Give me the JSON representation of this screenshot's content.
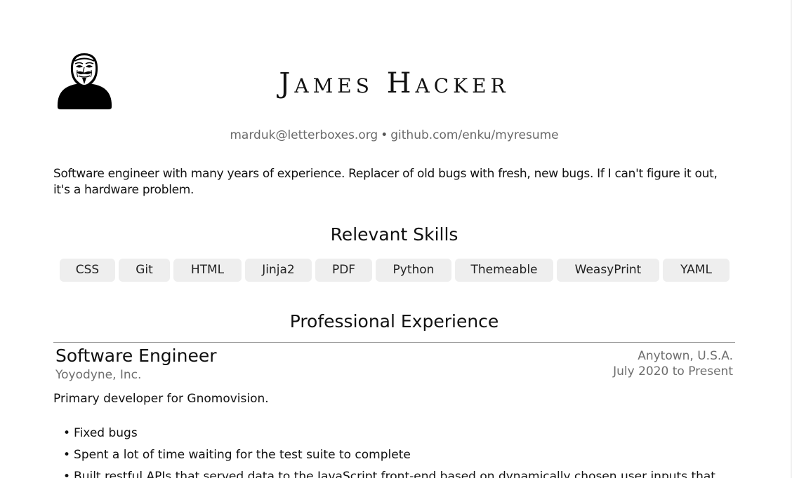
{
  "header": {
    "name": "James Hacker",
    "email": "marduk@letterboxes.org",
    "separator": "•",
    "website": "github.com/enku/myresume",
    "avatar_icon": "anonymous-mask-avatar-icon"
  },
  "summary": "Software engineer with many years of experience. Replacer of old bugs with fresh, new bugs. If I can't figure it out, it's a hardware problem.",
  "skills": {
    "title": "Relevant Skills",
    "items": [
      "CSS",
      "Git",
      "HTML",
      "Jinja2",
      "PDF",
      "Python",
      "Themeable",
      "WeasyPrint",
      "YAML"
    ]
  },
  "experience": {
    "title": "Professional Experience",
    "jobs": [
      {
        "title": "Software Engineer",
        "company": "Yoyodyne, Inc.",
        "location": "Anytown, U.S.A.",
        "dates": "July 2020 to Present",
        "description": "Primary developer for Gnomovision.",
        "bullets": [
          "Fixed bugs",
          "Spent a lot of time waiting for the test suite to complete",
          "Built restful APIs that served data to the JavaScript front-end based on dynamically chosen user inputs that"
        ]
      }
    ]
  }
}
